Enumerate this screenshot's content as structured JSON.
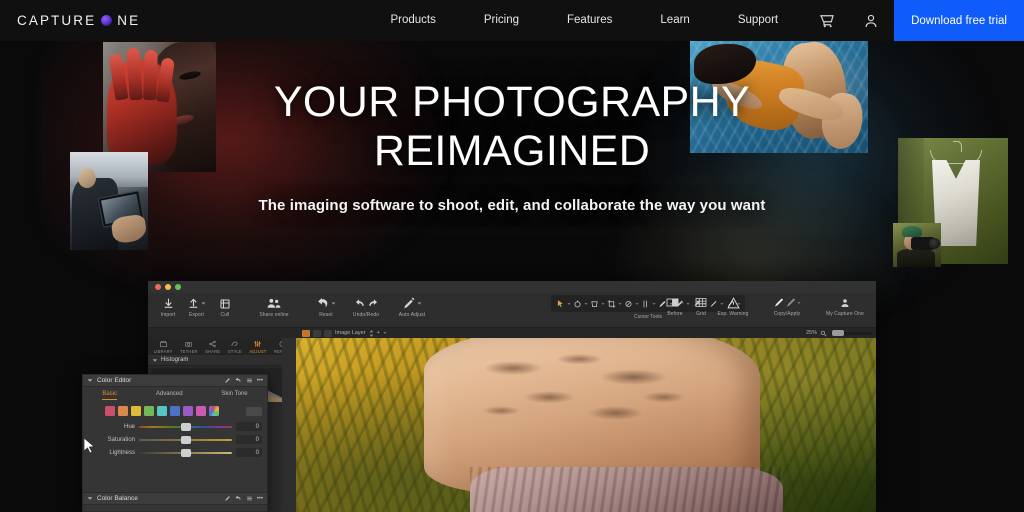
{
  "nav": {
    "logo": {
      "text_before": "CAPTURE",
      "text_after": "NE",
      "dot_icon": "gradient-o-icon",
      "accent": "#6b3fe0"
    },
    "links": [
      {
        "label": "Products"
      },
      {
        "label": "Pricing"
      },
      {
        "label": "Features"
      },
      {
        "label": "Learn"
      },
      {
        "label": "Support"
      }
    ],
    "icons": [
      {
        "name": "cart-icon"
      },
      {
        "name": "account-icon"
      }
    ],
    "cta": {
      "label": "Download free trial",
      "color": "#0f5cfb"
    },
    "bar_color": "#101011"
  },
  "hero": {
    "title_line1": "YOUR PHOTOGRAPHY",
    "title_line2": "REIMAGINED",
    "subtitle": "The imaging software to shoot, edit, and collaborate the way you want",
    "background": "#0a0a0b",
    "photos": [
      {
        "name": "portrait-with-hand-photo",
        "alt": "Portrait with raised red-lit hand"
      },
      {
        "name": "tablet-tethering-photo",
        "alt": "Person holding tablet outdoors"
      },
      {
        "name": "pool-swimmers-photo",
        "alt": "Swimmers in blue pool water"
      },
      {
        "name": "green-garment-photo",
        "alt": "White top on hanger against green backdrop"
      },
      {
        "name": "photographer-photo",
        "alt": "Photographer with camera"
      }
    ]
  },
  "app": {
    "window_controls": [
      "close",
      "minimize",
      "zoom"
    ],
    "toolbar_left": [
      {
        "label": "Import",
        "icon": "import-icon"
      },
      {
        "label": "Export",
        "icon": "export-icon"
      },
      {
        "label": "Cull",
        "icon": "cull-icon"
      },
      {
        "label": "Share online",
        "icon": "share-icon"
      },
      {
        "label": "Reset",
        "icon": "reset-icon"
      },
      {
        "label": "Undo/Redo",
        "icon": "undo-redo-icon"
      },
      {
        "label": "Auto Adjust",
        "icon": "auto-adjust-icon"
      }
    ],
    "cursor_tools": {
      "label": "Cursor Tools",
      "count": 11
    },
    "toolbar_right": [
      {
        "label": "Before",
        "icon": "before-after-icon"
      },
      {
        "label": "Grid",
        "icon": "grid-icon"
      },
      {
        "label": "Exp. Warning",
        "icon": "warning-triangle-icon"
      },
      {
        "label": "Copy/Apply",
        "icon": "copy-apply-icon"
      },
      {
        "label": "My Capture One",
        "icon": "account-icon"
      }
    ],
    "subbar": {
      "layer_label": "Image Layer",
      "add_label": "+",
      "zoom_level": "25%",
      "zoom_icon": "magnifier-icon"
    },
    "tool_tabs": [
      {
        "label": "LIBRARY",
        "icon": "library-icon",
        "active": false
      },
      {
        "label": "TETHER",
        "icon": "tether-icon",
        "active": false
      },
      {
        "label": "SHARE",
        "icon": "share-tab-icon",
        "active": false
      },
      {
        "label": "STYLE",
        "icon": "style-icon",
        "active": false
      },
      {
        "label": "ADJUST",
        "icon": "adjust-icon",
        "active": true
      },
      {
        "label": "REFINE",
        "icon": "refine-icon",
        "active": false
      }
    ],
    "histogram_panel": {
      "title": "Histogram",
      "collapse_icon": "chevron-down-icon",
      "menu_icon": "ellipsis-icon"
    },
    "color_editor": {
      "title": "Color Editor",
      "collapse_icon": "chevron-down-icon",
      "tools": [
        "picker-icon",
        "reset-icon",
        "list-icon",
        "ellipsis-icon"
      ],
      "tabs": [
        {
          "label": "Basic",
          "active": true
        },
        {
          "label": "Advanced",
          "active": false
        },
        {
          "label": "Skin Tone",
          "active": false
        }
      ],
      "swatches": [
        "#c8506a",
        "#d98a4a",
        "#e0bb3a",
        "#74b85a",
        "#55c6c0",
        "#4a73c8",
        "#9a5ac8",
        "#cc5ab0",
        "#multi"
      ],
      "sliders": [
        {
          "label": "Hue",
          "value": "0"
        },
        {
          "label": "Saturation",
          "value": "0"
        },
        {
          "label": "Lightness",
          "value": "0"
        }
      ]
    },
    "color_balance": {
      "title": "Color Balance",
      "collapse_icon": "chevron-down-icon"
    },
    "viewer_photo": {
      "name": "editing-preview-photo",
      "alt": "Torso with leaf shadows against yellow flowers"
    }
  }
}
